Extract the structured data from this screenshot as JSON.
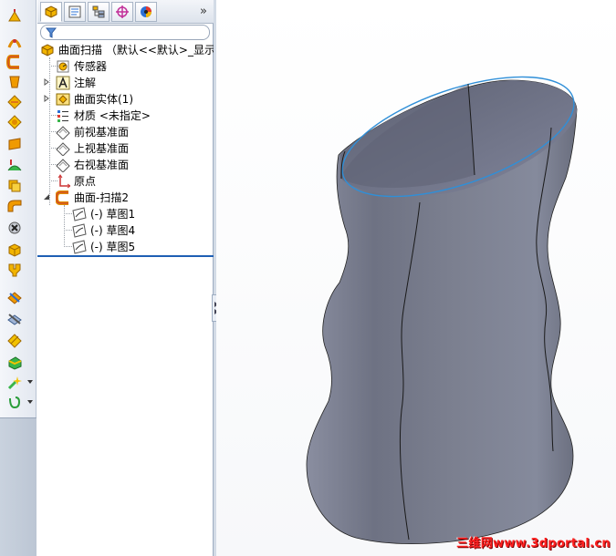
{
  "feature_tree": {
    "tabs": [
      {
        "name": "feature-manager",
        "active": true
      },
      {
        "name": "property-manager",
        "active": false
      },
      {
        "name": "configuration-manager",
        "active": false
      },
      {
        "name": "dimxpert-manager",
        "active": false
      },
      {
        "name": "display-manager",
        "active": false
      }
    ],
    "more": "»",
    "root": "曲面扫描 （默认<<默认>_显示",
    "items": [
      {
        "label": "传感器",
        "icon": "sensor-icon"
      },
      {
        "label": "注解",
        "icon": "annotation-icon"
      },
      {
        "label": "曲面实体(1)",
        "icon": "surface-body-icon"
      },
      {
        "label": "材质 <未指定>",
        "icon": "material-icon"
      },
      {
        "label": "前视基准面",
        "icon": "plane-icon"
      },
      {
        "label": "上视基准面",
        "icon": "plane-icon"
      },
      {
        "label": "右视基准面",
        "icon": "plane-icon"
      },
      {
        "label": "原点",
        "icon": "origin-icon"
      },
      {
        "label": "曲面-扫描2",
        "icon": "surface-sweep-icon"
      }
    ],
    "sweep_children": [
      {
        "label": "(-) 草图1",
        "icon": "sketch-icon"
      },
      {
        "label": "(-) 草图4",
        "icon": "sketch-icon"
      },
      {
        "label": "(-) 草图5",
        "icon": "sketch-icon"
      }
    ]
  },
  "toolbar_icons": [
    "extruded-surface-icon",
    "revolved-surface-icon",
    "swept-surface-icon",
    "lofted-surface-icon",
    "boundary-surface-icon",
    "filled-surface-icon",
    "planar-surface-icon",
    "offset-surface-icon",
    "ruled-surface-icon",
    "radiate-surface-icon",
    "knit-surface-icon",
    "untrim-surface-icon",
    "delete-face-icon",
    "extend-surface-icon",
    "trim-surface-icon",
    "thicken-icon",
    "replace-face-icon",
    "cut-with-surface-icon",
    "curves-icon",
    "freeform-icon"
  ],
  "colors": {
    "model_fill": "#7b7f8e",
    "model_edge_highlight": "#2f8fd8",
    "rollback_bar": "#1e5fb4"
  },
  "watermark": "三维网www.3dportal.cn"
}
